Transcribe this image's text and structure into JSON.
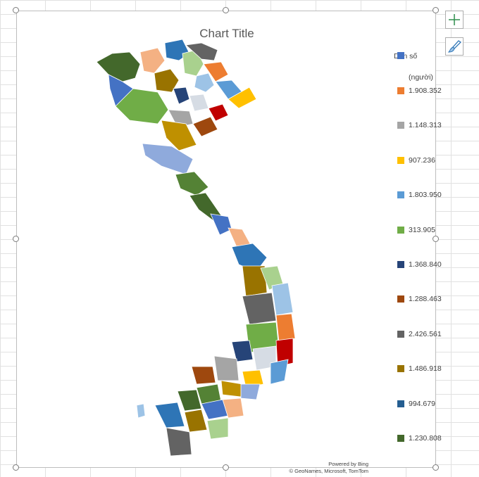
{
  "chart_data": {
    "type": "map",
    "title": "Chart Title",
    "legend_title": "Dân số",
    "legend_subtitle": "(người)",
    "legend_position": "right",
    "entries": [
      {
        "label": "",
        "color": "#4472c4"
      },
      {
        "label": "1.908.352",
        "color": "#ed7d31"
      },
      {
        "label": "1.148.313",
        "color": "#a5a5a5"
      },
      {
        "label": "907.236",
        "color": "#ffc000"
      },
      {
        "label": "1.803.950",
        "color": "#5b9bd5"
      },
      {
        "label": "313.905",
        "color": "#70ad47"
      },
      {
        "label": "1.368.840",
        "color": "#264478"
      },
      {
        "label": "1.288.463",
        "color": "#9e480e"
      },
      {
        "label": "2.426.561",
        "color": "#636363"
      },
      {
        "label": "1.486.918",
        "color": "#997300"
      },
      {
        "label": "994.679",
        "color": "#255e91"
      },
      {
        "label": "1.230.808",
        "color": "#43682b"
      }
    ],
    "map_region_colors": [
      "#43682b",
      "#4472c4",
      "#f4b183",
      "#2e75b6",
      "#997300",
      "#a9d18e",
      "#636363",
      "#9dc3e6",
      "#ed7d31",
      "#70ad47",
      "#264478",
      "#d6dce4",
      "#c00000",
      "#5b9bd5",
      "#ffc000",
      "#a5a5a5",
      "#9e480e",
      "#bf9000",
      "#8faadc",
      "#548235"
    ]
  },
  "credits": {
    "line1": "Powered by Bing",
    "line2": "© GeoNames, Microsoft, TomTom"
  },
  "buttons": {
    "add_icon": "plus-icon",
    "style_icon": "brush-icon"
  }
}
